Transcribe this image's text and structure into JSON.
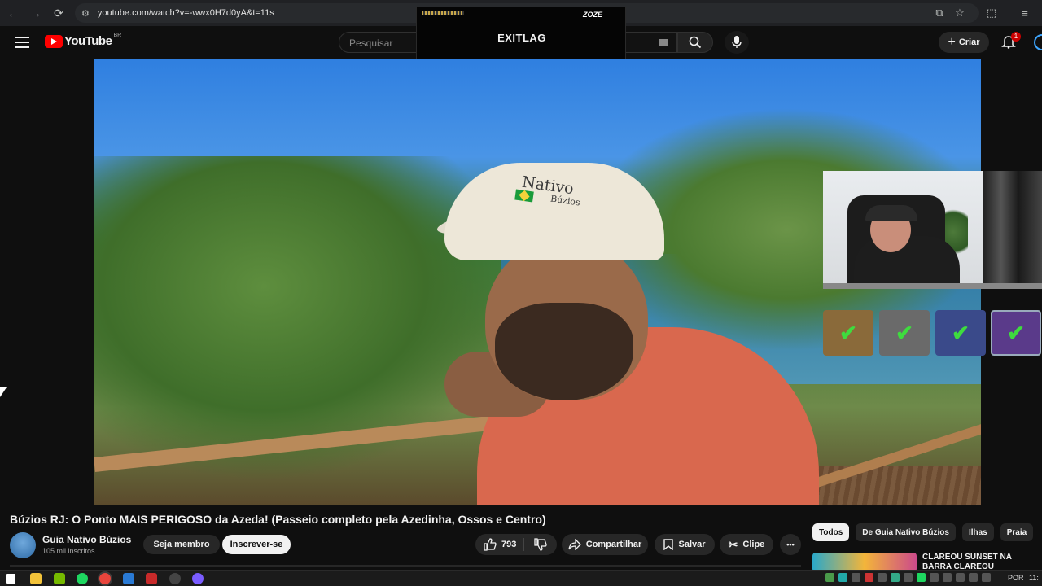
{
  "browser": {
    "url": "youtube.com/watch?v=-wwx0H7d0yA&t=11s"
  },
  "header": {
    "logo_text": "YouTube",
    "region": "BR",
    "search_placeholder": "Pesquisar",
    "create_label": "Criar",
    "notification_count": "1"
  },
  "overlay": {
    "brand": "EXITLAG",
    "sponsor": "ZOZE",
    "dots": "••"
  },
  "video": {
    "cap_text": "Nativo",
    "cap_subtext": "Búzios",
    "title": "Búzios RJ: O Ponto MAIS PERIGOSO da Azeda! (Passeio completo pela Azedinha, Ossos e Centro)"
  },
  "channel": {
    "name": "Guia Nativo Búzios",
    "subscribers": "105 mil inscritos",
    "member_label": "Seja membro",
    "subscribe_label": "Inscrever-se"
  },
  "actions": {
    "likes": "793",
    "share_label": "Compartilhar",
    "save_label": "Salvar",
    "clip_label": "Clipe",
    "more_label": "•••"
  },
  "chips": [
    "Todos",
    "De Guia Nativo Búzios",
    "Ilhas",
    "Praia"
  ],
  "recommendation": {
    "title": "CLAREOU SUNSET NA BARRA CLAREOU"
  },
  "badges": {
    "check": "✔",
    "colors": [
      "#8a6a3a",
      "#6a6a6a",
      "#3a4a8a",
      "#5a3a8a"
    ]
  },
  "taskbar": {
    "lang": "POR",
    "time": "11:"
  },
  "colors": {
    "youtube_red": "#ff0000",
    "background": "#0f0f0f",
    "check_green": "#3edc3e"
  }
}
